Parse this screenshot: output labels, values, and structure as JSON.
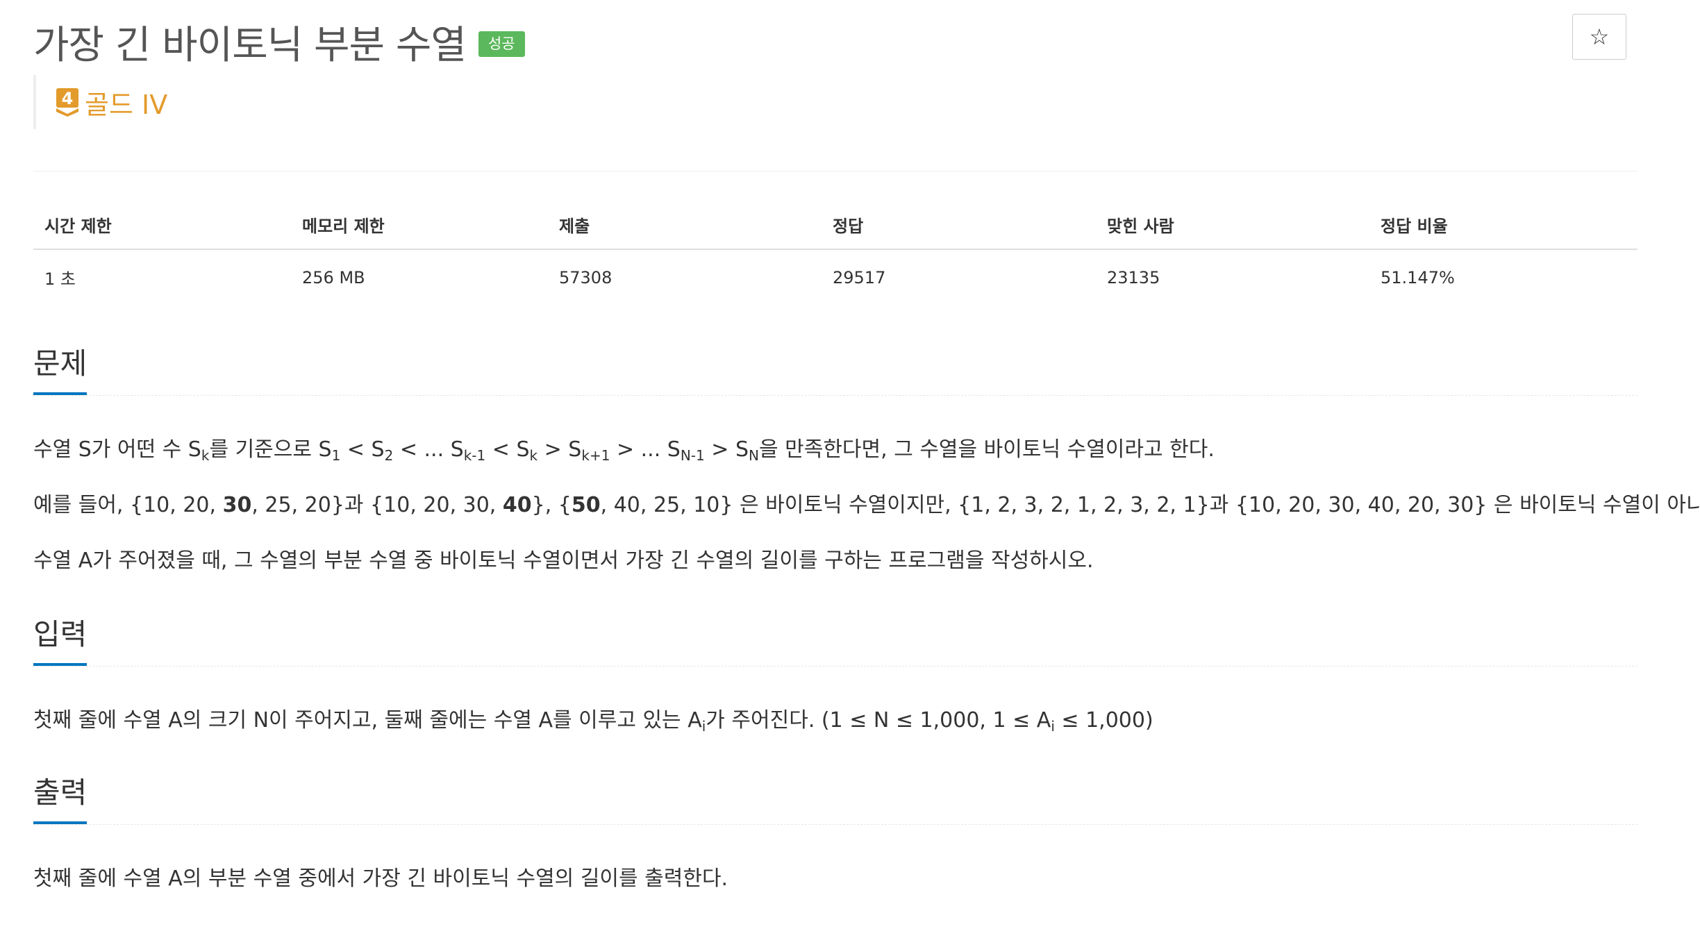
{
  "problem": {
    "title": "가장 긴 바이토닉 부분 수열",
    "status_badge": "성공",
    "star_icon": "☆",
    "tier_number": "4",
    "tier_label": "골드 IV"
  },
  "info_table": {
    "headers": [
      "시간 제한",
      "메모리 제한",
      "제출",
      "정답",
      "맞힌 사람",
      "정답 비율"
    ],
    "values": [
      "1 초",
      "256 MB",
      "57308",
      "29517",
      "23135",
      "51.147%"
    ]
  },
  "sections": {
    "problem": {
      "title": "문제",
      "line1": {
        "a": "수열 S가 어떤 수 S",
        "k1": "k",
        "b": "를 기준으로 S",
        "one": "1",
        "c": " < S",
        "two": "2",
        "d": " < ... S",
        "km1": "k-1",
        "e": " < S",
        "k2": "k",
        "f": " > S",
        "kp1": "k+1",
        "g": " > ... S",
        "nm1": "N-1",
        "h": " > S",
        "n": "N",
        "i": "을 만족한다면, 그 수열을 바이토닉 수열이라고 한다."
      },
      "line2": {
        "a": "예를 들어, {10, 20, ",
        "b1": "30",
        "b": ", 25, 20}과 {10, 20, 30, ",
        "b2": "40",
        "c": "}, {",
        "b3": "50",
        "d": ", 40, 25, 10} 은 바이토닉 수열이지만, {1, 2, 3, 2, 1, 2, 3, 2, 1}과 {10, 20, 30, 40, 20, 30} 은 바이토닉 수열이 아니다."
      },
      "line3": "수열 A가 주어졌을 때, 그 수열의 부분 수열 중 바이토닉 수열이면서 가장 긴 수열의 길이를 구하는 프로그램을 작성하시오."
    },
    "input": {
      "title": "입력",
      "line": {
        "a": "첫째 줄에 수열 A의 크기 N이 주어지고, 둘째 줄에는 수열 A를 이루고 있는 A",
        "i1": "i",
        "b": "가 주어진다. (1 ≤ N ≤ 1,000, 1 ≤ A",
        "i2": "i",
        "c": " ≤ 1,000)"
      }
    },
    "output": {
      "title": "출력",
      "line": "첫째 줄에 수열 A의 부분 수열 중에서 가장 긴 바이토닉 수열의 길이를 출력한다."
    }
  },
  "colors": {
    "badge_success": "#5cb85c",
    "tier_gold": "#e39b2b",
    "section_underline": "#0076c0"
  }
}
